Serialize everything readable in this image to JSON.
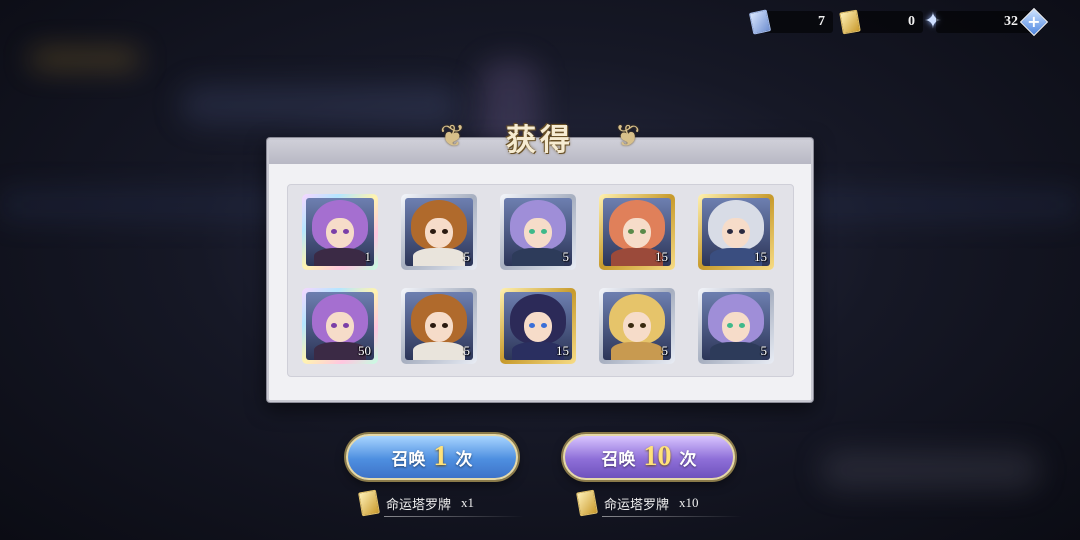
{
  "currencies": [
    {
      "icon": "blue-card-icon",
      "value": "7"
    },
    {
      "icon": "gold-card-icon",
      "value": "0"
    },
    {
      "icon": "star-crystal-icon",
      "value": "32"
    }
  ],
  "panel": {
    "title": "获得"
  },
  "items": [
    {
      "qty": "1",
      "frame": "rainbow",
      "hair": "#a56fd0",
      "eye": "#7b3fa8",
      "body": "#3b2a45"
    },
    {
      "qty": "5",
      "frame": "silver",
      "hair": "#b06a2c",
      "eye": "#2b1a10",
      "body": "#e9e4dc"
    },
    {
      "qty": "5",
      "frame": "silver",
      "hair": "#9f8ed8",
      "eye": "#3fb98a",
      "body": "#2d3b5a"
    },
    {
      "qty": "15",
      "frame": "gold",
      "hair": "#e0805a",
      "eye": "#5a8a4a",
      "body": "#9b4a3a"
    },
    {
      "qty": "15",
      "frame": "gold",
      "hair": "#d8dce6",
      "eye": "#2a2a40",
      "body": "#3a4e80"
    },
    {
      "qty": "50",
      "frame": "rainbow",
      "hair": "#a56fd0",
      "eye": "#7b3fa8",
      "body": "#3b2a45"
    },
    {
      "qty": "5",
      "frame": "silver",
      "hair": "#b06a2c",
      "eye": "#2b1a10",
      "body": "#e9e4dc"
    },
    {
      "qty": "15",
      "frame": "gold",
      "hair": "#2c2a58",
      "eye": "#3a6fd8",
      "body": "#2a2f60"
    },
    {
      "qty": "5",
      "frame": "silver",
      "hair": "#e6c46a",
      "eye": "#3a2a10",
      "body": "#c89a50"
    },
    {
      "qty": "5",
      "frame": "silver",
      "hair": "#9f8ed8",
      "eye": "#3fb98a",
      "body": "#2d3b5a"
    }
  ],
  "buttons": {
    "summon_one": {
      "prefix": "召唤",
      "count": "1",
      "suffix": "次"
    },
    "summon_ten": {
      "prefix": "召唤",
      "count": "10",
      "suffix": "次"
    }
  },
  "costs": {
    "one": {
      "item": "命运塔罗牌",
      "count": "x1"
    },
    "ten": {
      "item": "命运塔罗牌",
      "count": "x10"
    }
  }
}
